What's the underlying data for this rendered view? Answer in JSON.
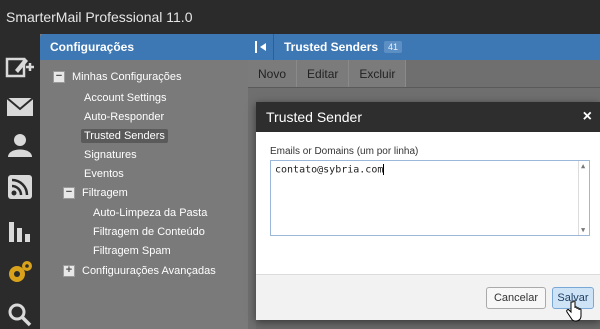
{
  "app": {
    "title": "SmarterMail Professional 11.0"
  },
  "rail": {
    "icons": [
      "compose-icon",
      "mail-icon",
      "contacts-icon",
      "rss-icon",
      "reports-icon",
      "settings-icon",
      "search-icon"
    ]
  },
  "nav": {
    "header": "Configurações",
    "items": [
      {
        "label": "Minhas Configurações",
        "toggle": "−"
      },
      {
        "label": "Account Settings"
      },
      {
        "label": "Auto-Responder"
      },
      {
        "label": "Trusted Senders"
      },
      {
        "label": "Signatures"
      },
      {
        "label": "Eventos"
      },
      {
        "label": "Filtragem",
        "toggle": "−"
      },
      {
        "label": "Auto-Limpeza da Pasta"
      },
      {
        "label": "Filtragem de Conteúdo"
      },
      {
        "label": "Filtragem Spam"
      },
      {
        "label": "Configuurações Avançadas",
        "toggle": "+"
      }
    ]
  },
  "content": {
    "title": "Trusted Senders",
    "count": "41",
    "toolbar": {
      "new": "Novo",
      "edit": "Editar",
      "delete": "Excluir"
    }
  },
  "modal": {
    "title": "Trusted Sender",
    "close": "×",
    "field_label": "Emails or Domains (um por linha)",
    "field_value": "contato@sybria.com",
    "cancel_label": "Cancelar",
    "save_label": "Salvar"
  },
  "colors": {
    "accent": "#3d78b4",
    "header_dark": "#2b2b2b",
    "gear_gold": "#d8a31b"
  }
}
